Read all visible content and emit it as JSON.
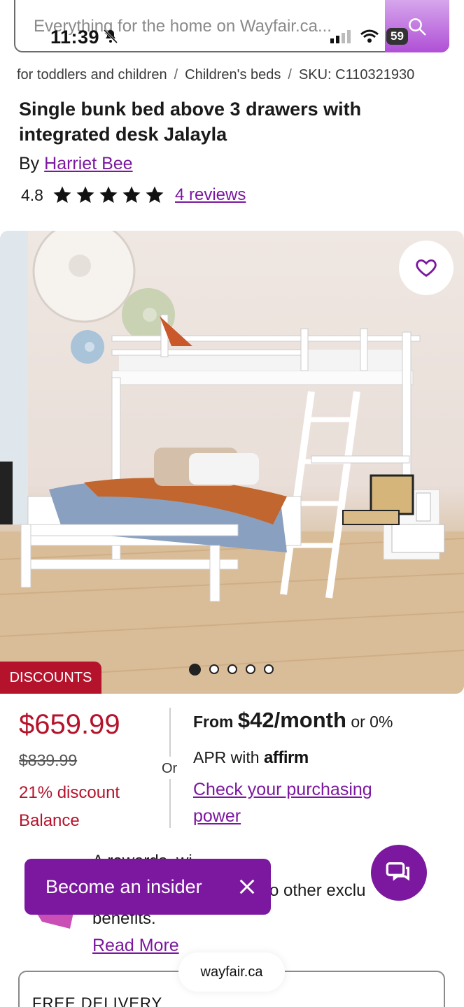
{
  "search": {
    "placeholder": "Everything for the home on Wayfair.ca..."
  },
  "status_bar": {
    "time": "11:39",
    "battery": "59"
  },
  "breadcrumb": {
    "items": [
      "for toddlers and children",
      "Children's beds",
      "SKU: C110321930"
    ]
  },
  "product": {
    "title": "Single bunk bed above 3 drawers with integrated desk Jalayla",
    "by_label": "By",
    "brand": "Harriet Bee",
    "rating": "4.8",
    "rating_value": 4.8,
    "stars_max": 5,
    "reviews_label": "4 reviews",
    "image_count": 5,
    "image_index": 1,
    "badge": "DISCOUNTS"
  },
  "pricing": {
    "price": "$659.99",
    "old_price": "$839.99",
    "discount": "21% discount",
    "balance": "Balance",
    "or_label": "Or",
    "financing_from": "From",
    "financing_amount": "$42/month",
    "financing_or": "or 0%",
    "financing_apr": "APR with",
    "affirm": "affirm",
    "check_link": "Check your purchasing power"
  },
  "rewards": {
    "line1": "A                rewards, wi",
    "line2": "o other exclu",
    "line3": "benefits.",
    "read_more": "Read More"
  },
  "insider": {
    "label": "Become an insider"
  },
  "delivery": {
    "label": "FREE DELIVERY"
  },
  "browser": {
    "url": "wayfair.ca"
  },
  "colors": {
    "brand_purple": "#7b189f",
    "sale_red": "#b5132b",
    "search_button": "#b04fd6"
  }
}
